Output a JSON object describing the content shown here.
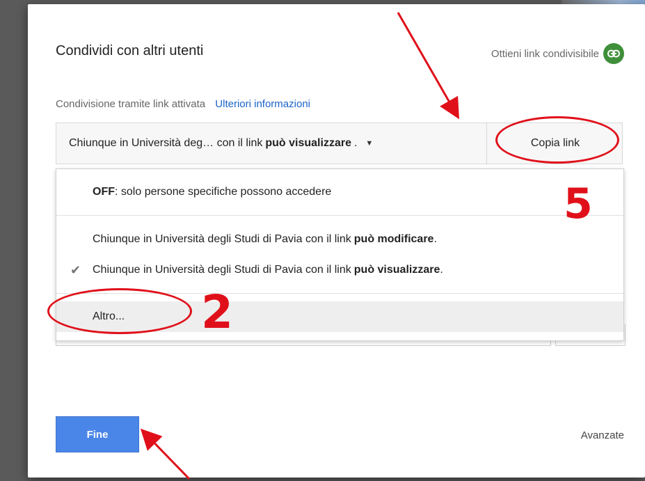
{
  "dialog": {
    "title": "Condividi con altri utenti",
    "get_link_label": "Ottieni link condivisibile",
    "status_text": "Condivisione tramite link attivata",
    "more_info_link": "Ulteriori informazioni",
    "share_select": {
      "prefix": "Chiunque in Università deg…  con il link",
      "bold": "può visualizzare",
      "suffix": "."
    },
    "copy_link_label": "Copia link",
    "menu": {
      "off_option": {
        "bold": "OFF",
        "text": ": solo persone specifiche possono accedere"
      },
      "edit_option": {
        "text": "Chiunque in Università degli Studi di Pavia con il link",
        "bold": "può modificare",
        "tail": "."
      },
      "view_option": {
        "text": "Chiunque in Università degli Studi di Pavia con il link",
        "bold": "può visualizzare",
        "tail": "."
      },
      "other_option": "Altro..."
    },
    "done_label": "Fine",
    "advanced_label": "Avanzate"
  },
  "annotations": {
    "number_copy": "5",
    "number_other": "2",
    "color": "#e0101a"
  },
  "icons": {
    "link": "link-icon",
    "check": "check-icon",
    "caret": "caret-down-icon"
  },
  "colors": {
    "done_button": "#4a86e8",
    "link_icon_bg": "#3f8f3a",
    "info_link": "#1a62c9"
  }
}
